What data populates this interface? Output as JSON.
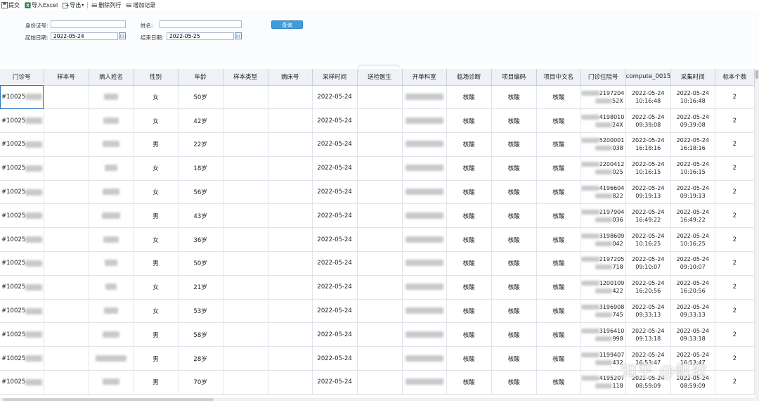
{
  "toolbar": {
    "submit": "提交",
    "import_excel": "导入Excel",
    "export": "导出",
    "delete_row": "删除列行",
    "add_record": "增加记录"
  },
  "form": {
    "id_label": "身份证号:",
    "id_value": "",
    "name_label": "姓名:",
    "name_value": "",
    "start_label": "起始日期:",
    "start_value": "2022-05-24",
    "end_label": "结束日期:",
    "end_value": "2022-05-25",
    "query_button": "查询"
  },
  "table": {
    "columns": [
      "门诊号",
      "样本号",
      "病人姓名",
      "性别",
      "年龄",
      "样本类型",
      "病床号",
      "采样时间",
      "送检医生",
      "开单科室",
      "临场诊断",
      "项目编码",
      "项目中文名",
      "门诊住院号",
      "compute_0015",
      "采集时间",
      "标本个数"
    ],
    "rows": [
      {
        "id": "#10025",
        "gender": "女",
        "age": "50岁",
        "sample_date": "2022-05-24",
        "diag": "核酸",
        "code": "核酸",
        "cn": "核酸",
        "hosp_a": "2197204",
        "hosp_b": "52X",
        "cd": "2022-05-24",
        "ct": "10:16:48",
        "qd": "2022-05-24",
        "qt": "10:16:48",
        "count": "2"
      },
      {
        "id": "#10025",
        "gender": "女",
        "age": "42岁",
        "sample_date": "2022-05-24",
        "diag": "核酸",
        "code": "核酸",
        "cn": "核酸",
        "hosp_a": "4198010",
        "hosp_b": "24X",
        "cd": "2022-05-24",
        "ct": "09:39:08",
        "qd": "2022-05-24",
        "qt": "09:39:08",
        "count": "2"
      },
      {
        "id": "#10025",
        "gender": "男",
        "age": "22岁",
        "sample_date": "2022-05-24",
        "diag": "核酸",
        "code": "核酸",
        "cn": "核酸",
        "hosp_a": "5200001",
        "hosp_b": "038",
        "cd": "2022-05-24",
        "ct": "16:18:16",
        "qd": "2022-05-24",
        "qt": "16:18:16",
        "count": "2"
      },
      {
        "id": "#10025",
        "gender": "女",
        "age": "18岁",
        "sample_date": "2022-05-24",
        "diag": "核酸",
        "code": "核酸",
        "cn": "核酸",
        "hosp_a": "2200412",
        "hosp_b": "025",
        "cd": "2022-05-24",
        "ct": "10:16:15",
        "qd": "2022-05-24",
        "qt": "10:16:15",
        "count": "2"
      },
      {
        "id": "#10025",
        "gender": "女",
        "age": "56岁",
        "sample_date": "2022-05-24",
        "diag": "核酸",
        "code": "核酸",
        "cn": "核酸",
        "hosp_a": "4196604",
        "hosp_b": "822",
        "cd": "2022-05-24",
        "ct": "09:19:13",
        "qd": "2022-05-24",
        "qt": "09:19:13",
        "count": "2"
      },
      {
        "id": "#10025",
        "gender": "男",
        "age": "43岁",
        "sample_date": "2022-05-24",
        "diag": "核酸",
        "code": "核酸",
        "cn": "核酸",
        "hosp_a": "2197904",
        "hosp_b": "036",
        "cd": "2022-05-24",
        "ct": "16:49:22",
        "qd": "2022-05-24",
        "qt": "16:49:22",
        "count": "2"
      },
      {
        "id": "#10025",
        "gender": "女",
        "age": "36岁",
        "sample_date": "2022-05-24",
        "diag": "核酸",
        "code": "核酸",
        "cn": "核酸",
        "hosp_a": "3198609",
        "hosp_b": "042",
        "cd": "2022-05-24",
        "ct": "10:16:25",
        "qd": "2022-05-24",
        "qt": "10:16:25",
        "count": "2"
      },
      {
        "id": "#10025",
        "gender": "男",
        "age": "50岁",
        "sample_date": "2022-05-24",
        "diag": "核酸",
        "code": "核酸",
        "cn": "核酸",
        "hosp_a": "2197205",
        "hosp_b": "718",
        "cd": "2022-05-24",
        "ct": "09:10:07",
        "qd": "2022-05-24",
        "qt": "09:10:07",
        "count": "2"
      },
      {
        "id": "#10025",
        "gender": "女",
        "age": "21岁",
        "sample_date": "2022-05-24",
        "diag": "核酸",
        "code": "核酸",
        "cn": "核酸",
        "hosp_a": "1200109",
        "hosp_b": "422",
        "cd": "2022-05-24",
        "ct": "16:20:56",
        "qd": "2022-05-24",
        "qt": "16:20:56",
        "count": "2"
      },
      {
        "id": "#10025",
        "gender": "女",
        "age": "53岁",
        "sample_date": "2022-05-24",
        "diag": "核酸",
        "code": "核酸",
        "cn": "核酸",
        "hosp_a": "3196908",
        "hosp_b": "745",
        "cd": "2022-05-24",
        "ct": "09:33:13",
        "qd": "2022-05-24",
        "qt": "09:33:13",
        "count": "2"
      },
      {
        "id": "#10025",
        "gender": "男",
        "age": "58岁",
        "sample_date": "2022-05-24",
        "diag": "核酸",
        "code": "核酸",
        "cn": "核酸",
        "hosp_a": "3196410",
        "hosp_b": "998",
        "cd": "2022-05-24",
        "ct": "09:13:18",
        "qd": "2022-05-24",
        "qt": "09:13:18",
        "count": "2"
      },
      {
        "id": "#10025",
        "gender": "男",
        "age": "28岁",
        "sample_date": "2022-05-24",
        "diag": "核酸",
        "code": "核酸",
        "cn": "核酸",
        "hosp_a": "1199407",
        "hosp_b": "432",
        "cd": "2022-05-24",
        "ct": "16:53:47",
        "qd": "2022-05-24",
        "qt": "16:53:47",
        "count": "2"
      },
      {
        "id": "#10025",
        "gender": "男",
        "age": "70岁",
        "sample_date": "2022-05-24",
        "diag": "核酸",
        "code": "核酸",
        "cn": "核酸",
        "hosp_a": "4195207",
        "hosp_b": "118",
        "cd": "2022-05-24",
        "ct": "08:59:09",
        "qd": "2022-05-24",
        "qt": "08:59:09",
        "count": "2"
      }
    ]
  },
  "watermark": "知乎 @帆软",
  "colors": {
    "accent": "#3d9cde",
    "header_bg": "#eef2f7",
    "grid_line": "#dfe5ec"
  },
  "icons": {
    "submit": "save-icon",
    "import_excel": "excel-icon",
    "export": "export-icon",
    "delete_row": "delete-row-icon",
    "add_record": "add-record-icon"
  }
}
